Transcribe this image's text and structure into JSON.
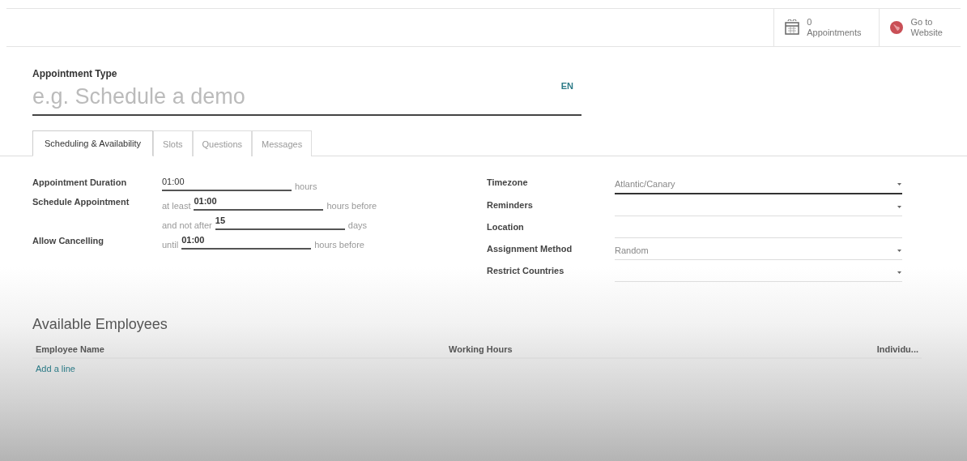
{
  "header_buttons": [
    {
      "kind": "calendar",
      "count": "0",
      "label": "Appointments"
    },
    {
      "kind": "globe",
      "count": "Go to",
      "label": "Website"
    }
  ],
  "title_field": {
    "label": "Appointment Type",
    "placeholder": "e.g. Schedule a demo",
    "lang": "EN"
  },
  "tabs": [
    {
      "label": "Scheduling & Availability",
      "selected": true
    },
    {
      "label": "Slots",
      "selected": false
    },
    {
      "label": "Questions",
      "selected": false
    },
    {
      "label": "Messages",
      "selected": false
    }
  ],
  "left_fields": [
    {
      "label": "Appointment Duration",
      "value": "01:00",
      "suffix": "hours"
    },
    {
      "label": "Schedule Appointment",
      "prefix": "at least",
      "value": "01:00",
      "suffix": "hours before"
    },
    {
      "prefix": "and not after",
      "value": "15",
      "suffix": "days"
    },
    {
      "label": "Allow Cancelling",
      "prefix": "until",
      "value": "01:00",
      "suffix": "hours before"
    }
  ],
  "right_fields": [
    {
      "label": "Timezone",
      "value": "Atlantic/Canary",
      "dropdown": true,
      "focused": true
    },
    {
      "label": "Reminders",
      "dropdown": true,
      "focused": false
    },
    {
      "label": "Location",
      "dropdown": false,
      "focused": false
    },
    {
      "label": "Assignment Method",
      "value": "Random",
      "dropdown": true,
      "focused": false
    },
    {
      "label": "Restrict Countries",
      "dropdown": true,
      "focused": false
    }
  ],
  "employees": {
    "title": "Available Employees",
    "columns": [
      "Employee Name",
      "Working Hours",
      "Individu..."
    ],
    "add_line": "Add a line"
  }
}
